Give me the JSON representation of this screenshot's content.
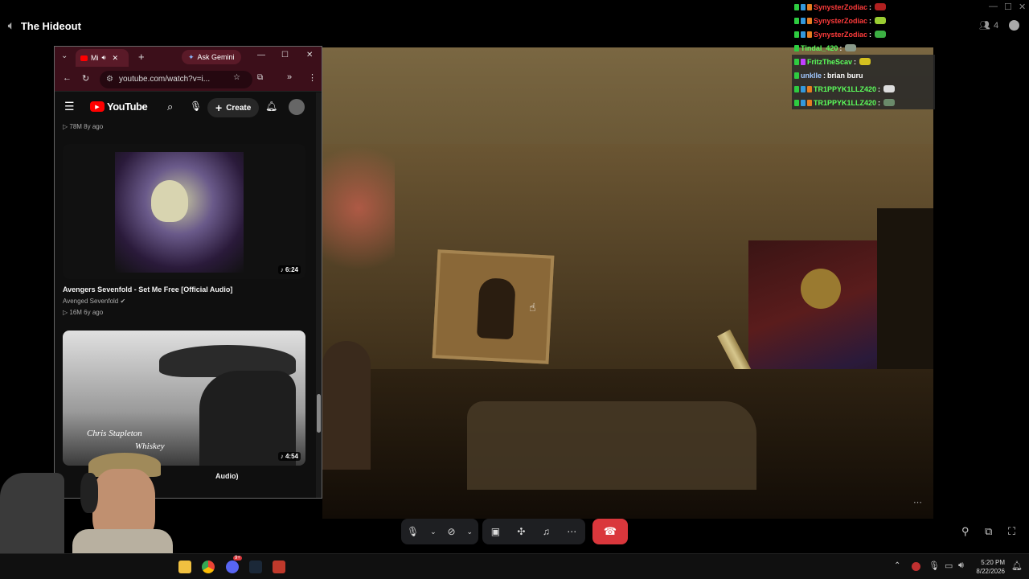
{
  "discord": {
    "channel_name": "The Hideout",
    "participant_count": "4"
  },
  "chat": [
    {
      "user": "SynysterZodiac",
      "message": "",
      "color": "#ff3b3b"
    },
    {
      "user": "SynysterZodiac",
      "message": "",
      "color": "#ff3b3b"
    },
    {
      "user": "SynysterZodiac",
      "message": "",
      "color": "#ff3b3b"
    },
    {
      "user": "Tindal_420",
      "message": "",
      "color": "#5cff5c"
    },
    {
      "user": "FritzTheScav",
      "message": "",
      "color": "#5cff5c"
    },
    {
      "user": "unklle",
      "message": "brian buru",
      "color": "#a0c8ff"
    },
    {
      "user": "TR1PPYK1LLZ420",
      "message": "",
      "color": "#5cff5c"
    },
    {
      "user": "TR1PPYK1LLZ420",
      "message": "",
      "color": "#5cff5c"
    }
  ],
  "browser": {
    "tab_title": "Mi",
    "gemini_label": "Ask Gemini",
    "url": "youtube.com/watch?v=i..."
  },
  "youtube": {
    "logo_text": "YouTube",
    "create_label": "Create",
    "prev_meta": "78M  8y ago",
    "videos": [
      {
        "title": "Avengers Sevenfold - Set Me Free [Official Audio]",
        "channel": "Avenged Sevenfold",
        "meta": "16M  6y ago",
        "duration": "6:24"
      },
      {
        "title": "Audio)",
        "thumb_text_1": "Chris Stapleton",
        "thumb_text_2": "Whiskey",
        "duration": "4:54"
      }
    ]
  },
  "taskbar": {
    "time": "5:20 PM",
    "date": "8/22/2026",
    "discord_badge": "9+"
  },
  "colors": {
    "end_call": "#da373c",
    "browser_frame": "#3c0f1a",
    "chat_green": "#5cff5c",
    "chat_red": "#ff3b3b"
  }
}
